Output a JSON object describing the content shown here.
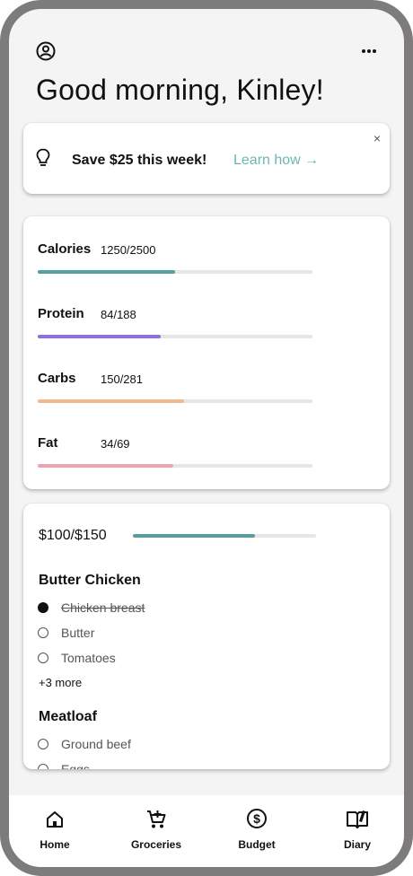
{
  "header": {
    "greeting": "Good morning, Kinley!"
  },
  "tip": {
    "text": "Save $25 this week!",
    "link": "Learn how →",
    "close": "×"
  },
  "macros": [
    {
      "name": "Calories",
      "value": "1250/2500",
      "progress": 0.5,
      "color": "#55a09f"
    },
    {
      "name": "Protein",
      "value": "84/188",
      "progress": 0.447,
      "color": "#8e6fe0"
    },
    {
      "name": "Carbs",
      "value": "150/281",
      "progress": 0.534,
      "color": "#f2b98f"
    },
    {
      "name": "Fat",
      "value": "34/69",
      "progress": 0.493,
      "color": "#eea3b5"
    }
  ],
  "groceries": {
    "budget_label": "$100/$150",
    "budget_progress": 0.667,
    "recipes": [
      {
        "title": "Butter Chicken",
        "items": [
          {
            "label": "Chicken breast",
            "checked": true
          },
          {
            "label": "Butter",
            "checked": false
          },
          {
            "label": "Tomatoes",
            "checked": false
          }
        ],
        "more": "+3 more"
      },
      {
        "title": "Meatloaf",
        "items": [
          {
            "label": "Ground beef",
            "checked": false
          },
          {
            "label": "Eggs",
            "checked": false
          }
        ]
      }
    ]
  },
  "nav": [
    {
      "label": "Home",
      "icon": "home-icon"
    },
    {
      "label": "Groceries",
      "icon": "cart-icon"
    },
    {
      "label": "Budget",
      "icon": "dollar-circle-icon"
    },
    {
      "label": "Diary",
      "icon": "book-icon"
    }
  ]
}
